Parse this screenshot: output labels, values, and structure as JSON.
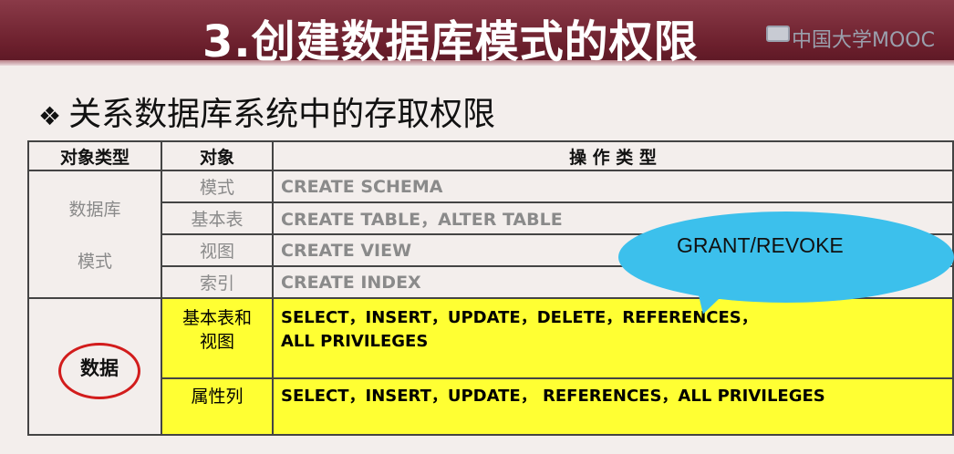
{
  "header": {
    "title": "3.创建数据库模式的权限",
    "watermark": "中国大学MOOC"
  },
  "heading": {
    "bullet": "❖",
    "text": "关系数据库系统中的存取权限"
  },
  "table": {
    "headers": [
      "对象类型",
      "对象",
      "操 作 类 型"
    ],
    "group1": {
      "type_line1": "数据库",
      "type_line2": "模式",
      "rows": [
        {
          "object": "模式",
          "ops": "CREATE SCHEMA"
        },
        {
          "object": "基本表",
          "ops": "CREATE TABLE，ALTER TABLE"
        },
        {
          "object": "视图",
          "ops": "CREATE VIEW"
        },
        {
          "object": "索引",
          "ops": "CREATE INDEX"
        }
      ]
    },
    "group2": {
      "type": "数据",
      "rows": [
        {
          "object_line1": "基本表和",
          "object_line2": "视图",
          "ops_line1": "SELECT，INSERT，UPDATE，DELETE，REFERENCES，",
          "ops_line2": "ALL PRIVILEGES"
        },
        {
          "object_line1": "属性列",
          "ops_line1": "SELECT，INSERT，UPDATE， REFERENCES，ALL PRIVILEGES"
        }
      ]
    }
  },
  "callout": {
    "text": "GRANT/REVOKE",
    "color": "#3cc0ec"
  },
  "colors": {
    "title_bg": "#6b1f2c",
    "highlight": "#ffff33",
    "circle": "#d21c1c"
  }
}
